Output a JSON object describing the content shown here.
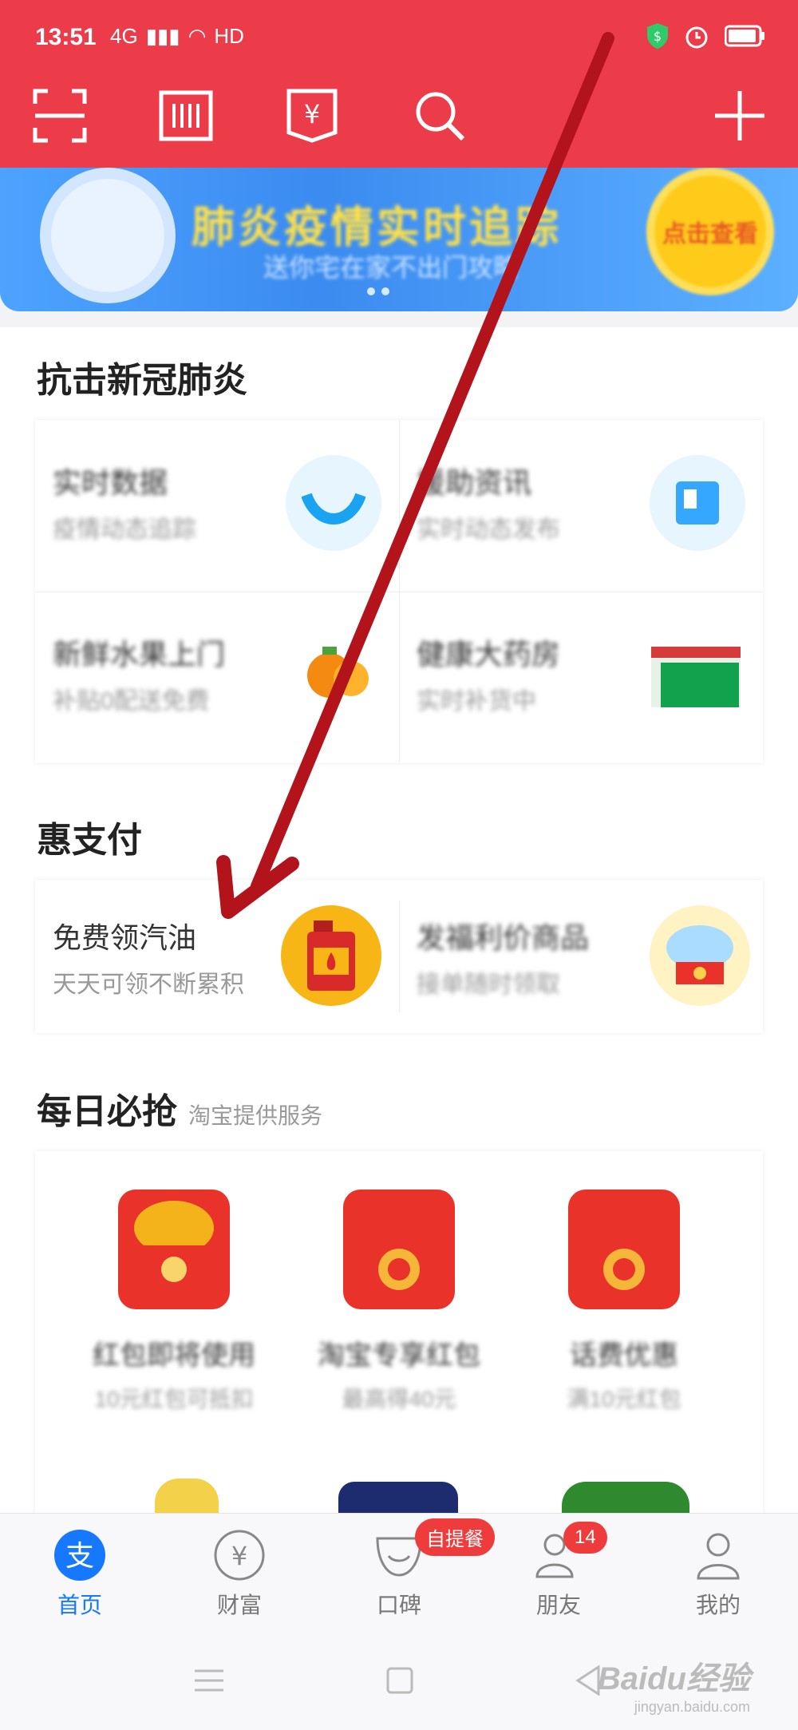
{
  "status": {
    "time": "13:51",
    "network": "4G",
    "hd": "HD"
  },
  "banner": {
    "title": "肺炎疫情实时追踪",
    "subtitle": "送你宅在家不出门攻略",
    "coin_text": "点击查看"
  },
  "sections": {
    "covid": {
      "title": "抗击新冠肺炎",
      "items": [
        {
          "title": "实时数据",
          "sub": "疫情动态追踪"
        },
        {
          "title": "援助资讯",
          "sub": "实时动态发布"
        },
        {
          "title": "新鲜水果上门",
          "sub": "补贴0配送免费"
        },
        {
          "title": "健康大药房",
          "sub": "实时补货中"
        }
      ]
    },
    "huizhifu": {
      "title": "惠支付",
      "items": [
        {
          "title": "免费领汽油",
          "sub": "天天可领不断累积"
        },
        {
          "title": "发福利价商品",
          "sub": "接单随时领取"
        }
      ]
    },
    "daily": {
      "title": "每日必抢",
      "provider": "淘宝提供服务",
      "items": [
        {
          "name": "红包即将使用",
          "sub": "10元红包可抵扣"
        },
        {
          "name": "淘宝专享红包",
          "sub": "最高得40元"
        },
        {
          "name": "话费优惠",
          "sub": "满10元红包"
        }
      ]
    }
  },
  "bottom_nav": [
    {
      "label": "首页",
      "active": true
    },
    {
      "label": "财富",
      "active": false
    },
    {
      "label": "口碑",
      "badge": "自提餐",
      "active": false
    },
    {
      "label": "朋友",
      "badge": "14",
      "active": false
    },
    {
      "label": "我的",
      "active": false
    }
  ],
  "watermark": {
    "main": "Baidu经验",
    "sub": "jingyan.baidu.com"
  },
  "colors": {
    "brand_red": "#ec3c4a",
    "accent_blue": "#1677ff",
    "arrow": "#b3141c"
  }
}
